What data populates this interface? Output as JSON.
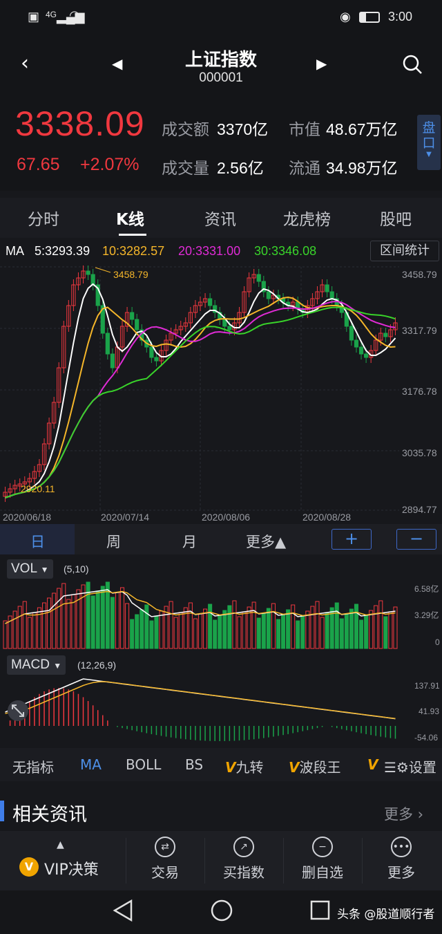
{
  "status": {
    "time": "3:00",
    "network": "4G"
  },
  "header": {
    "title": "上证指数",
    "code": "000001"
  },
  "quote": {
    "price": "3338.09",
    "change": "67.65",
    "change_pct": "+2.07%",
    "turnover_label": "成交额",
    "turnover_value": "3370亿",
    "market_cap_label": "市值",
    "market_cap_value": "48.67万亿",
    "volume_label": "成交量",
    "volume_value": "2.56亿",
    "float_label": "流通",
    "float_value": "34.98万亿",
    "pankou_label": "盘口"
  },
  "tabs": [
    "分时",
    "K线",
    "资讯",
    "龙虎榜",
    "股吧"
  ],
  "ma": {
    "prefix": "MA",
    "ma5": "5:3293.39",
    "ma10": "10:3282.57",
    "ma20": "20:3331.00",
    "ma30": "30:3346.08",
    "range_button": "区间统计"
  },
  "colors": {
    "up": "#f0383f",
    "down": "#1aa34a",
    "ma5": "#ffffff",
    "ma10": "#f5b62a",
    "ma20": "#e02bd6",
    "ma30": "#39d42a",
    "accent": "#4d8fe8"
  },
  "kline": {
    "y_labels": [
      "3458.79",
      "3317.79",
      "3176.78",
      "3035.78",
      "2894.77"
    ],
    "x_labels": [
      "2020/06/18",
      "2020/07/14",
      "2020/08/06",
      "2020/08/28"
    ],
    "high_annotation": "3458.79",
    "low_annotation": "2920.11"
  },
  "periods": {
    "day": "日",
    "week": "周",
    "month": "月",
    "more": "更多▲",
    "plus": "+",
    "minus": "−"
  },
  "vol": {
    "name": "VOL",
    "params": "(5,10)",
    "y_labels": [
      "6.58亿",
      "3.29亿",
      "0"
    ]
  },
  "macd": {
    "name": "MACD",
    "params": "(12,26,9)",
    "y_labels": [
      "137.91",
      "41.93",
      "-54.06"
    ]
  },
  "indicators": [
    "无指标",
    "MA",
    "BOLL",
    "BS",
    "九转",
    "波段王",
    "设置"
  ],
  "news": {
    "title": "相关资讯",
    "more": "更多 ›"
  },
  "actions": {
    "vip": "VIP决策",
    "trade": "交易",
    "buy_index": "买指数",
    "remove_watch": "删自选",
    "more": "更多"
  },
  "watermark": "头条 @股道顺行者"
}
